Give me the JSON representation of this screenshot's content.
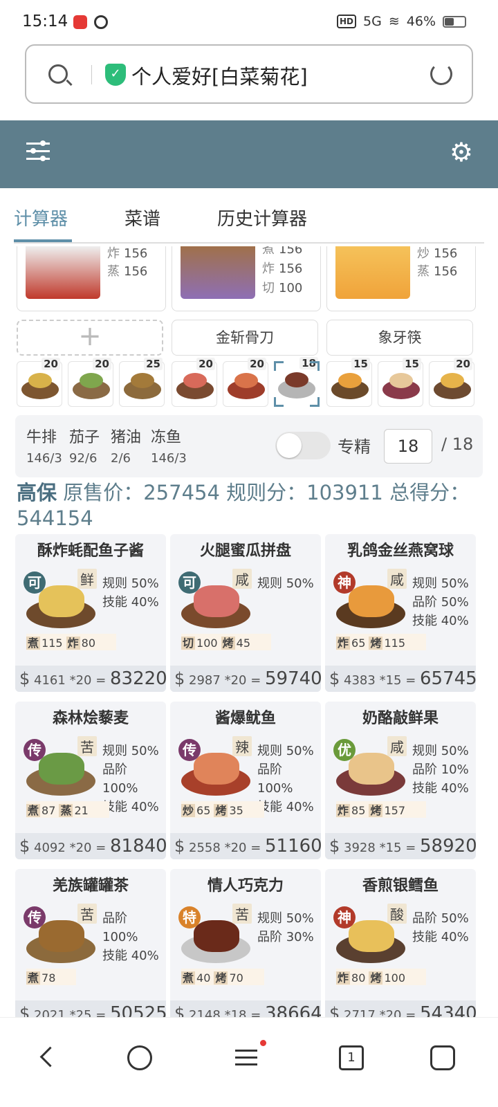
{
  "status": {
    "time": "15:14",
    "network": "5G",
    "battery": "46%",
    "hd": "HD"
  },
  "url": {
    "title": "个人爱好[白菜菊花]"
  },
  "app": {
    "tabs": [
      "计算器",
      "菜谱",
      "历史计算器"
    ],
    "active_tab": 0
  },
  "chefs": [
    {
      "skills": [
        {
          "k": "炸",
          "v": "156"
        },
        {
          "k": "蒸",
          "v": "156"
        }
      ],
      "color": "#c0392b"
    },
    {
      "skills": [
        {
          "k": "煮",
          "v": "156"
        },
        {
          "k": "炸",
          "v": "156"
        },
        {
          "k": "切",
          "v": "100"
        }
      ],
      "color": "#8e6fb5"
    },
    {
      "skills": [
        {
          "k": "炒",
          "v": "156"
        },
        {
          "k": "蒸",
          "v": "156"
        }
      ],
      "color": "#f0a33a"
    }
  ],
  "equipment": {
    "empty": "+",
    "slot2": "金斩骨刀",
    "slot3": "象牙筷"
  },
  "dish_icons": [
    {
      "qty": "20",
      "color": "#7d5630",
      "food": "#d8b24a"
    },
    {
      "qty": "20",
      "color": "#8a6a45",
      "food": "#7fa64d"
    },
    {
      "qty": "25",
      "color": "#8c6a3c",
      "food": "#a37a3a"
    },
    {
      "qty": "20",
      "color": "#7a4a30",
      "food": "#d86a5a"
    },
    {
      "qty": "20",
      "color": "#9e3d2a",
      "food": "#d9734a"
    },
    {
      "qty": "18",
      "color": "#b5b5b5",
      "food": "#7a3a2a",
      "selected": true
    },
    {
      "qty": "15",
      "color": "#6b4a2a",
      "food": "#e9a03c"
    },
    {
      "qty": "15",
      "color": "#8a3a4a",
      "food": "#e7c89a"
    },
    {
      "qty": "20",
      "color": "#6d4a30",
      "food": "#e6b34a"
    }
  ],
  "ingredients": [
    {
      "name": "牛排",
      "value": "146/3"
    },
    {
      "name": "茄子",
      "value": "92/6"
    },
    {
      "name": "猪油",
      "value": "2/6"
    },
    {
      "name": "冻鱼",
      "value": "146/3"
    }
  ],
  "expert": {
    "label": "专精",
    "value": "18",
    "max": "/ 18"
  },
  "summary": {
    "level": "高保",
    "text": "原售价：257454 规则分：103911 总得分：544154"
  },
  "dishes": [
    {
      "name": "酥炸蚝配鱼子酱",
      "rarity": "可",
      "rarity_color": "#3f6b73",
      "taste": "鲜",
      "rules": [
        "规则 50%",
        "技能 40%"
      ],
      "skills": [
        {
          "k": "煮",
          "v": "115"
        },
        {
          "k": "炸",
          "v": "80"
        }
      ],
      "unit": "4161",
      "mult": "*20",
      "total": "83220",
      "plate": "#6e4a2c",
      "food": "#e5c25a"
    },
    {
      "name": "火腿蜜瓜拼盘",
      "rarity": "可",
      "rarity_color": "#3f6b73",
      "taste": "咸",
      "rules": [
        "规则 50%"
      ],
      "skills": [
        {
          "k": "切",
          "v": "100"
        },
        {
          "k": "烤",
          "v": "45"
        }
      ],
      "unit": "2987",
      "mult": "*20",
      "total": "59740",
      "plate": "#7a4a2c",
      "food": "#d8706a"
    },
    {
      "name": "乳鸽金丝燕窝球",
      "rarity": "神",
      "rarity_color": "#b23a2a",
      "taste": "咸",
      "rules": [
        "规则 50%",
        "品阶 50%",
        "技能 40%"
      ],
      "skills": [
        {
          "k": "炸",
          "v": "65"
        },
        {
          "k": "烤",
          "v": "115"
        }
      ],
      "unit": "4383",
      "mult": "*15",
      "total": "65745",
      "plate": "#5a3a20",
      "food": "#e89a3c"
    },
    {
      "name": "森林烩藜麦",
      "rarity": "传",
      "rarity_color": "#7a3a6a",
      "taste": "苦",
      "rules": [
        "规则 50%",
        "品阶 100%",
        "技能 40%"
      ],
      "skills": [
        {
          "k": "煮",
          "v": "87"
        },
        {
          "k": "蒸",
          "v": "21"
        }
      ],
      "unit": "4092",
      "mult": "*20",
      "total": "81840",
      "plate": "#8a6a45",
      "food": "#6a9a45"
    },
    {
      "name": "酱爆鱿鱼",
      "rarity": "传",
      "rarity_color": "#7a3a6a",
      "taste": "辣",
      "rules": [
        "规则 50%",
        "品阶 100%",
        "技能 40%"
      ],
      "skills": [
        {
          "k": "炒",
          "v": "65"
        },
        {
          "k": "烤",
          "v": "35"
        }
      ],
      "unit": "2558",
      "mult": "*20",
      "total": "51160",
      "plate": "#a8402a",
      "food": "#e0845a"
    },
    {
      "name": "奶酪敲鲜果",
      "rarity": "优",
      "rarity_color": "#6a9a3a",
      "taste": "咸",
      "rules": [
        "规则 50%",
        "品阶 10%",
        "技能 40%"
      ],
      "skills": [
        {
          "k": "炸",
          "v": "85"
        },
        {
          "k": "烤",
          "v": "157"
        }
      ],
      "unit": "3928",
      "mult": "*15",
      "total": "58920",
      "plate": "#7a3a3a",
      "food": "#e9c48a"
    },
    {
      "name": "羌族罐罐茶",
      "rarity": "传",
      "rarity_color": "#7a3a6a",
      "taste": "苦",
      "rules": [
        "品阶 100%",
        "技能 40%"
      ],
      "skills": [
        {
          "k": "煮",
          "v": "78"
        }
      ],
      "unit": "2021",
      "mult": "*25",
      "total": "50525",
      "plate": "#8c6a3c",
      "food": "#9a6a30"
    },
    {
      "name": "情人巧克力",
      "rarity": "特",
      "rarity_color": "#d9822a",
      "taste": "苦",
      "rules": [
        "规则 50%",
        "品阶 30%"
      ],
      "skills": [
        {
          "k": "煮",
          "v": "40"
        },
        {
          "k": "烤",
          "v": "70"
        }
      ],
      "unit": "2148",
      "mult": "*18",
      "total": "38664",
      "plate": "#c7c7c7",
      "food": "#6a2a1a"
    },
    {
      "name": "香煎银鳕鱼",
      "rarity": "神",
      "rarity_color": "#b23a2a",
      "taste": "酸",
      "rules": [
        "品阶 50%",
        "技能 40%"
      ],
      "skills": [
        {
          "k": "炸",
          "v": "80"
        },
        {
          "k": "烤",
          "v": "100"
        }
      ],
      "unit": "2717",
      "mult": "*20",
      "total": "54340",
      "plate": "#5a4030",
      "food": "#e8c05a"
    }
  ],
  "nav": {
    "tabs_count": "1"
  }
}
